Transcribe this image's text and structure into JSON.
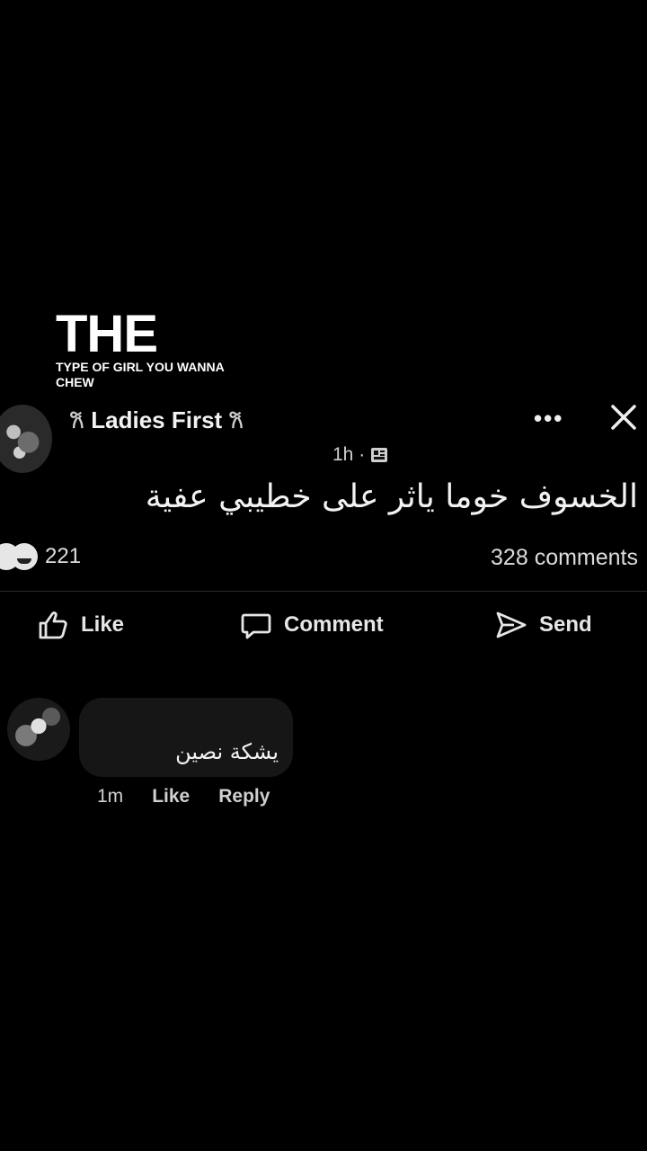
{
  "overlay": {
    "title": "THE",
    "subtitle": "TYPE OF GIRL YOU WANNA CHEW"
  },
  "post": {
    "page_name": "Ladies  First",
    "butterfly_icon": "butterfly-icon",
    "time": "1h ·",
    "text": "الخسوف خوما ياثر على خطيبي عفية",
    "reaction_count": "221",
    "comments_count": "328 comments"
  },
  "actions": {
    "like": "Like",
    "comment": "Comment",
    "send": "Send"
  },
  "comment": {
    "text": "يشكة نصين",
    "time": "1m",
    "like": "Like",
    "reply": "Reply"
  },
  "colors": {
    "background": "#000000",
    "text": "#e8e8e8",
    "bubble": "#161616"
  }
}
